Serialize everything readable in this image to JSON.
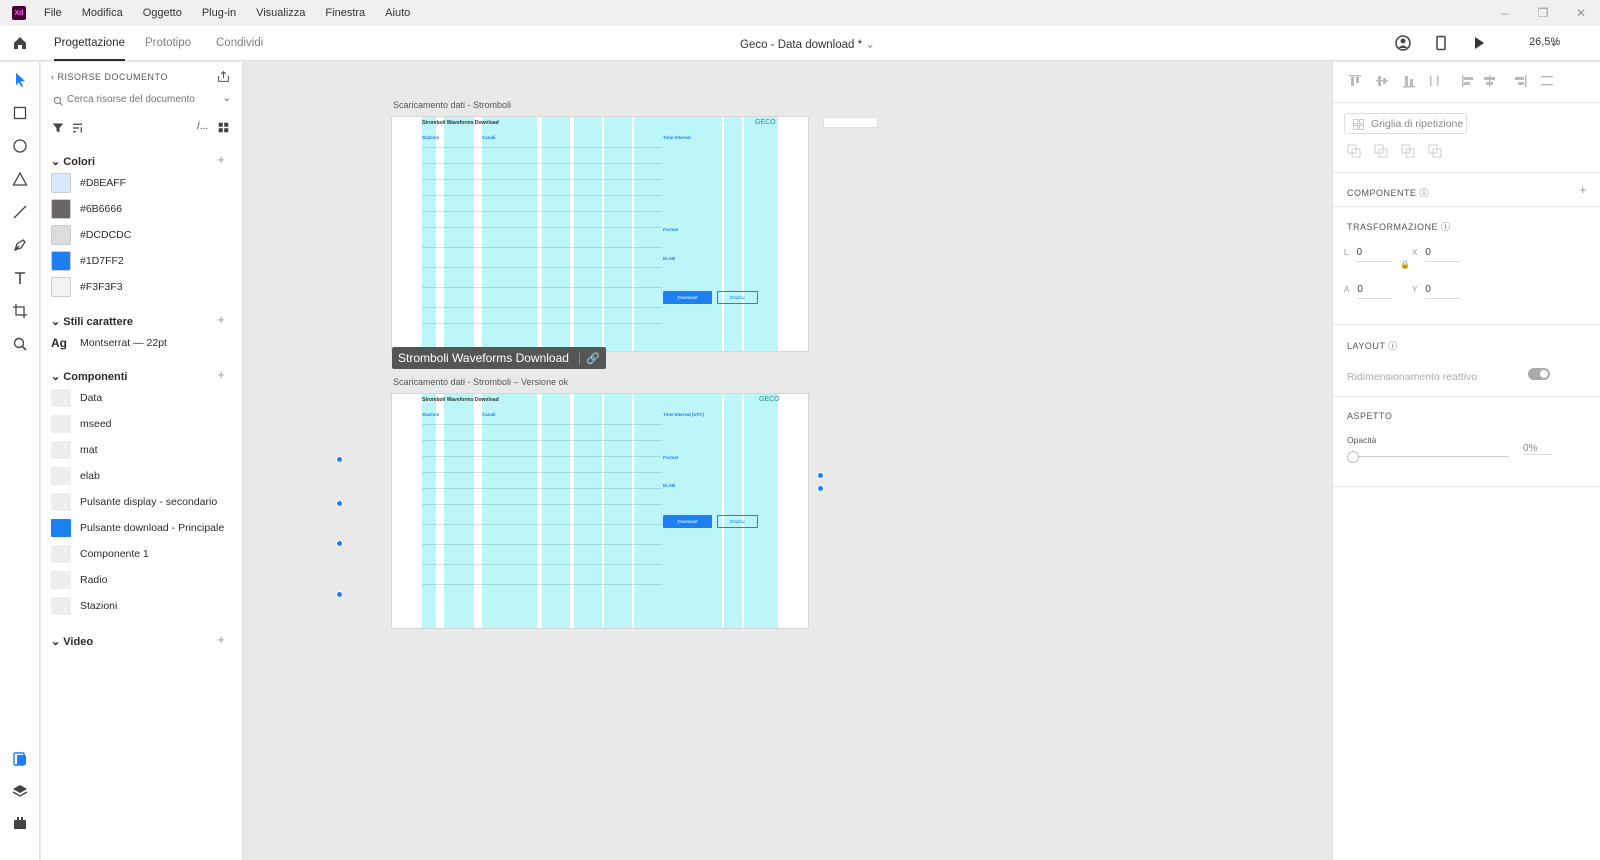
{
  "menubar": {
    "logo": "Xd",
    "items": [
      "File",
      "Modifica",
      "Oggetto",
      "Plug-in",
      "Visualizza",
      "Finestra",
      "Aiuto"
    ]
  },
  "toolbar": {
    "tabs": [
      "Progettazione",
      "Prototipo",
      "Condividi"
    ],
    "document_title": "Geco - Data download *",
    "zoom": "26,5%"
  },
  "assets": {
    "header": "RISORSE DOCUMENTO",
    "search_placeholder": "Cerca risorse del documento",
    "colors_title": "Colori",
    "colors": [
      {
        "hex": "#D8EAFF",
        "label": "#D8EAFF"
      },
      {
        "hex": "#6B6666",
        "label": "#6B6666"
      },
      {
        "hex": "#DCDCDC",
        "label": "#DCDCDC"
      },
      {
        "hex": "#1D7FF2",
        "label": "#1D7FF2"
      },
      {
        "hex": "#F3F3F3",
        "label": "#F3F3F3"
      }
    ],
    "char_styles_title": "Stili carattere",
    "char_style": {
      "preview": "Ag",
      "label": "Montserrat — 22pt"
    },
    "components_title": "Componenti",
    "components": [
      "Data",
      "mseed",
      "mat",
      "elab",
      "Pulsante display - secondario",
      "Pulsante download - Principale",
      "Componente 1",
      "Radio",
      "Stazioni"
    ],
    "video_title": "Video"
  },
  "canvas": {
    "artboard1_label": "Scaricamento dati - Stromboli",
    "artboard2_label": "Scaricamento dati - Stromboli – Versione ok",
    "artboard_title": "Stromboli Waveforms Download",
    "selected_tag": "Stromboli Waveforms Download",
    "section_station": "Stazioni",
    "section_channels": "Canali",
    "section_time1": "Time Interval",
    "section_time2": "Time Interval (UTC)",
    "section_format": "Format",
    "section_elab": "ELAB",
    "download_label": "Download",
    "display_label": "Display",
    "logo": "GECO"
  },
  "rightpanel": {
    "repeat_grid": "Griglia di ripetizione",
    "component_title": "COMPONENTE",
    "transform_title": "TRASFORMAZIONE",
    "w_label": "L",
    "w_value": "0",
    "h_label": "A",
    "h_value": "0",
    "x_label": "X",
    "x_value": "0",
    "y_label": "Y",
    "y_value": "0",
    "layout_title": "LAYOUT",
    "responsive_label": "Ridimensionamento reattivo",
    "appearance_title": "ASPETTO",
    "opacity_label": "Opacità",
    "opacity_value": "0%"
  }
}
